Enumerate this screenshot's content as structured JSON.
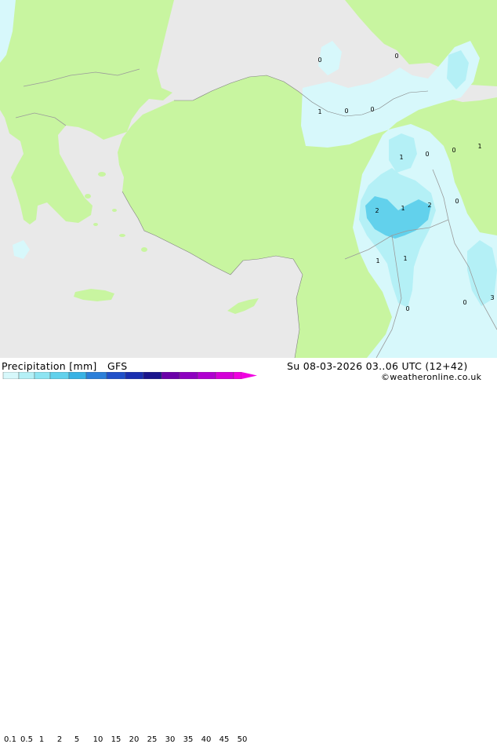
{
  "header": {
    "title": "Precipitation [mm]",
    "model": "GFS",
    "datetime": "Su 08-03-2026 03..06 UTC (12+42)",
    "credit": "©weatheronline.co.uk"
  },
  "legend": {
    "ticks": [
      "0.1",
      "0.5",
      "1",
      "2",
      "5",
      "10",
      "15",
      "20",
      "25",
      "30",
      "35",
      "40",
      "45",
      "50"
    ],
    "colors": [
      "#d7f8fb",
      "#b4f0f6",
      "#8ee4f2",
      "#62d1ec",
      "#38b2e4",
      "#2b7fd9",
      "#2050c9",
      "#1a2fb0",
      "#1a148c",
      "#6a00a8",
      "#8d00c0",
      "#b000d0",
      "#d400d8",
      "#f000e0"
    ]
  },
  "map": {
    "colors": {
      "sea": "#e9e9e9",
      "land": "#c8f5a0",
      "border": "#9a9a9a",
      "coast": "#7f7f7f"
    },
    "point_labels": [
      "0",
      "0",
      "1",
      "0",
      "0",
      "1",
      "0",
      "0",
      "1",
      "2",
      "1",
      "2",
      "0",
      "1",
      "1",
      "0",
      "0",
      "3"
    ]
  }
}
